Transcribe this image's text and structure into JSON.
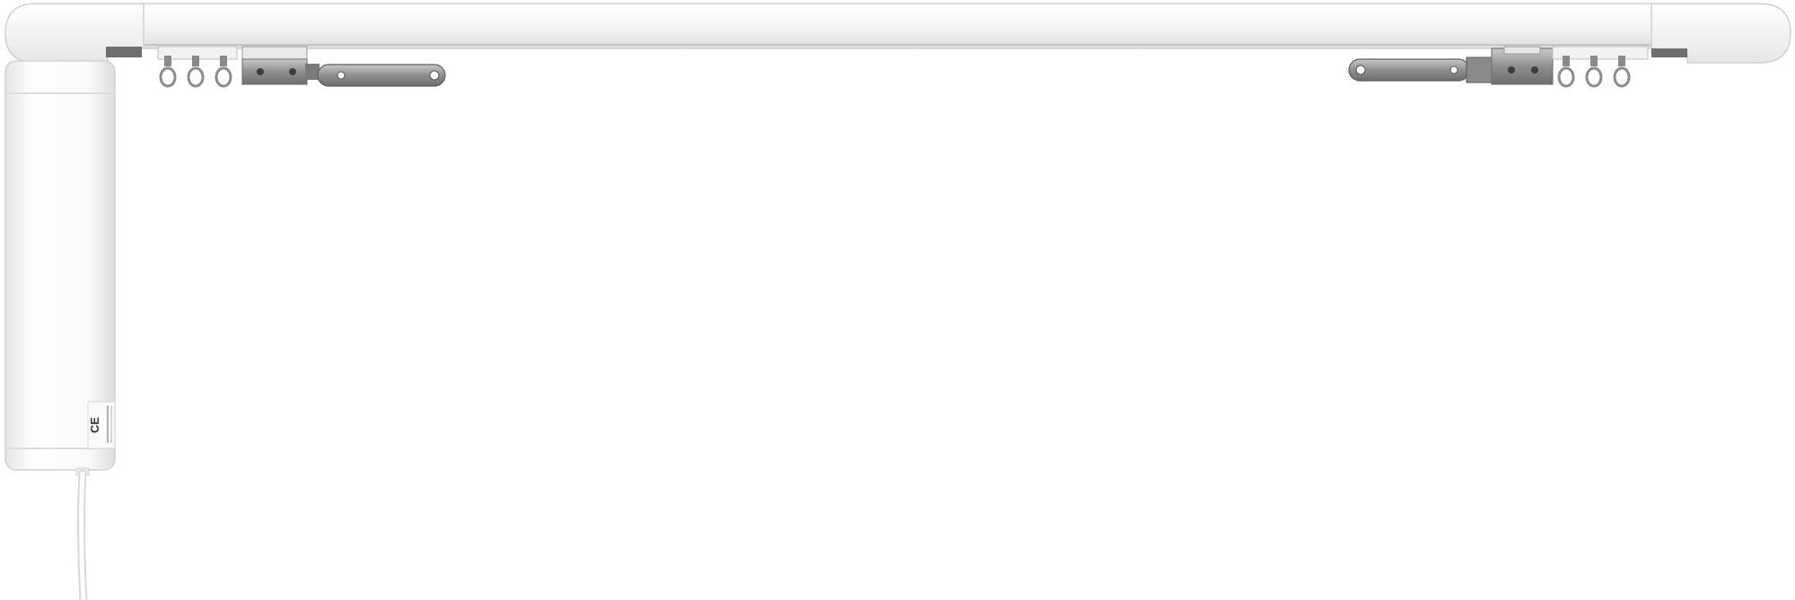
{
  "product": {
    "motor": {
      "label_lines": [
        "",
        "",
        ""
      ],
      "ce_mark": "CE"
    }
  },
  "colors": {
    "background": "#ffffff",
    "rail_white": "#f7f7f7",
    "rail_edge": "#cfcfcf",
    "motor_body": "#fbfbfb",
    "metal": "#9a9a9a",
    "metal_dark": "#5a5a5a"
  },
  "icons": [
    "curtain-rail",
    "electric-motor",
    "runner-hook",
    "master-carrier-bracket",
    "power-cable"
  ]
}
